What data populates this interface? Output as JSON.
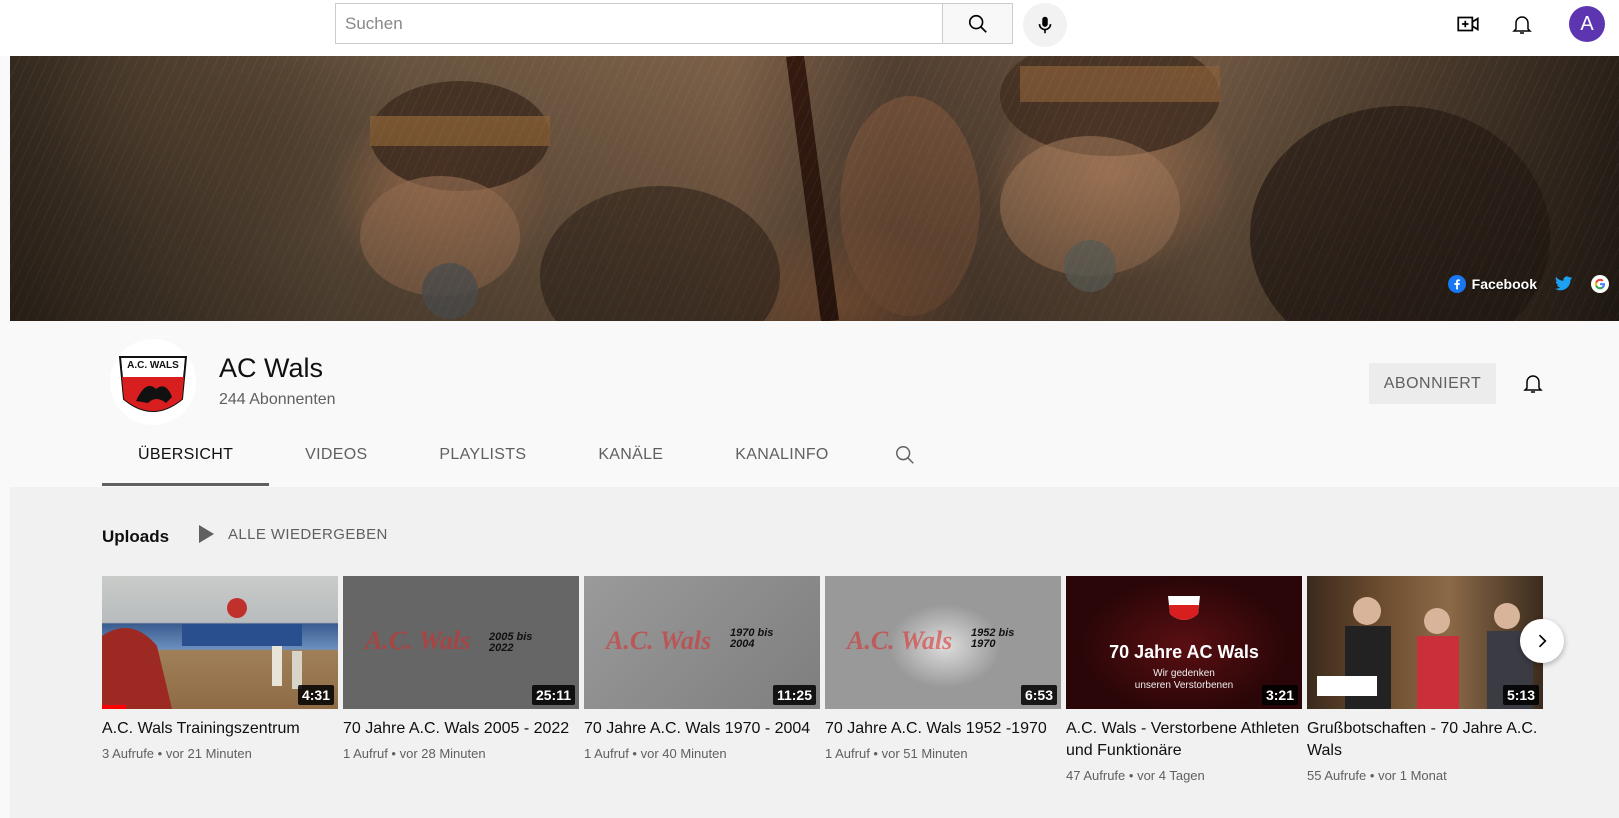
{
  "topbar": {
    "search_placeholder": "Suchen",
    "avatar_letter": "A"
  },
  "banner": {
    "links": [
      {
        "label": "Facebook"
      },
      {
        "label": ""
      },
      {
        "label": ""
      }
    ]
  },
  "channel": {
    "name": "AC Wals",
    "subscribers": "244 Abonnenten",
    "subscribe_label": "ABONNIERT",
    "logo_text": "A.C. WALS"
  },
  "tabs": [
    {
      "label": "ÜBERSICHT",
      "active": true
    },
    {
      "label": "VIDEOS"
    },
    {
      "label": "PLAYLISTS"
    },
    {
      "label": "KANÄLE"
    },
    {
      "label": "KANALINFO"
    }
  ],
  "shelf": {
    "title": "Uploads",
    "play_all": "ALLE WIEDERGEBEN"
  },
  "videos": [
    {
      "title": "A.C. Wals Trainingszentrum",
      "views": "3 Aufrufe",
      "age": "vor 21 Minuten",
      "duration": "4:31",
      "watched_fraction": 0.1
    },
    {
      "title": "70 Jahre A.C. Wals 2005 - 2022",
      "views": "1 Aufruf",
      "age": "vor 28 Minuten",
      "duration": "25:11",
      "thumb_logo": "A.C. Wals",
      "thumb_years": "2005 bis 2022"
    },
    {
      "title": "70 Jahre A.C. Wals 1970 - 2004",
      "views": "1 Aufruf",
      "age": "vor 40 Minuten",
      "duration": "11:25",
      "thumb_logo": "A.C. Wals",
      "thumb_years": "1970 bis 2004"
    },
    {
      "title": "70 Jahre A.C. Wals 1952 -1970",
      "views": "1 Aufruf",
      "age": "vor 51 Minuten",
      "duration": "6:53",
      "thumb_logo": "A.C. Wals",
      "thumb_years": "1952 bis 1970"
    },
    {
      "title": "A.C. Wals - Verstorbene Athleten und Funktionäre",
      "views": "47 Aufrufe",
      "age": "vor 4 Tagen",
      "duration": "3:21",
      "thumb_headline": "70 Jahre AC Wals",
      "thumb_sub": "Wir gedenken unseren Verstorbenen"
    },
    {
      "title": "Grußbotschaften - 70 Jahre A.C. Wals",
      "views": "55 Aufrufe",
      "age": "vor 1 Monat",
      "duration": "5:13"
    }
  ],
  "colors": {
    "accent_red": "#ff0000",
    "avatar_purple": "#5e35b1",
    "subscribe_bg": "#ececec"
  }
}
